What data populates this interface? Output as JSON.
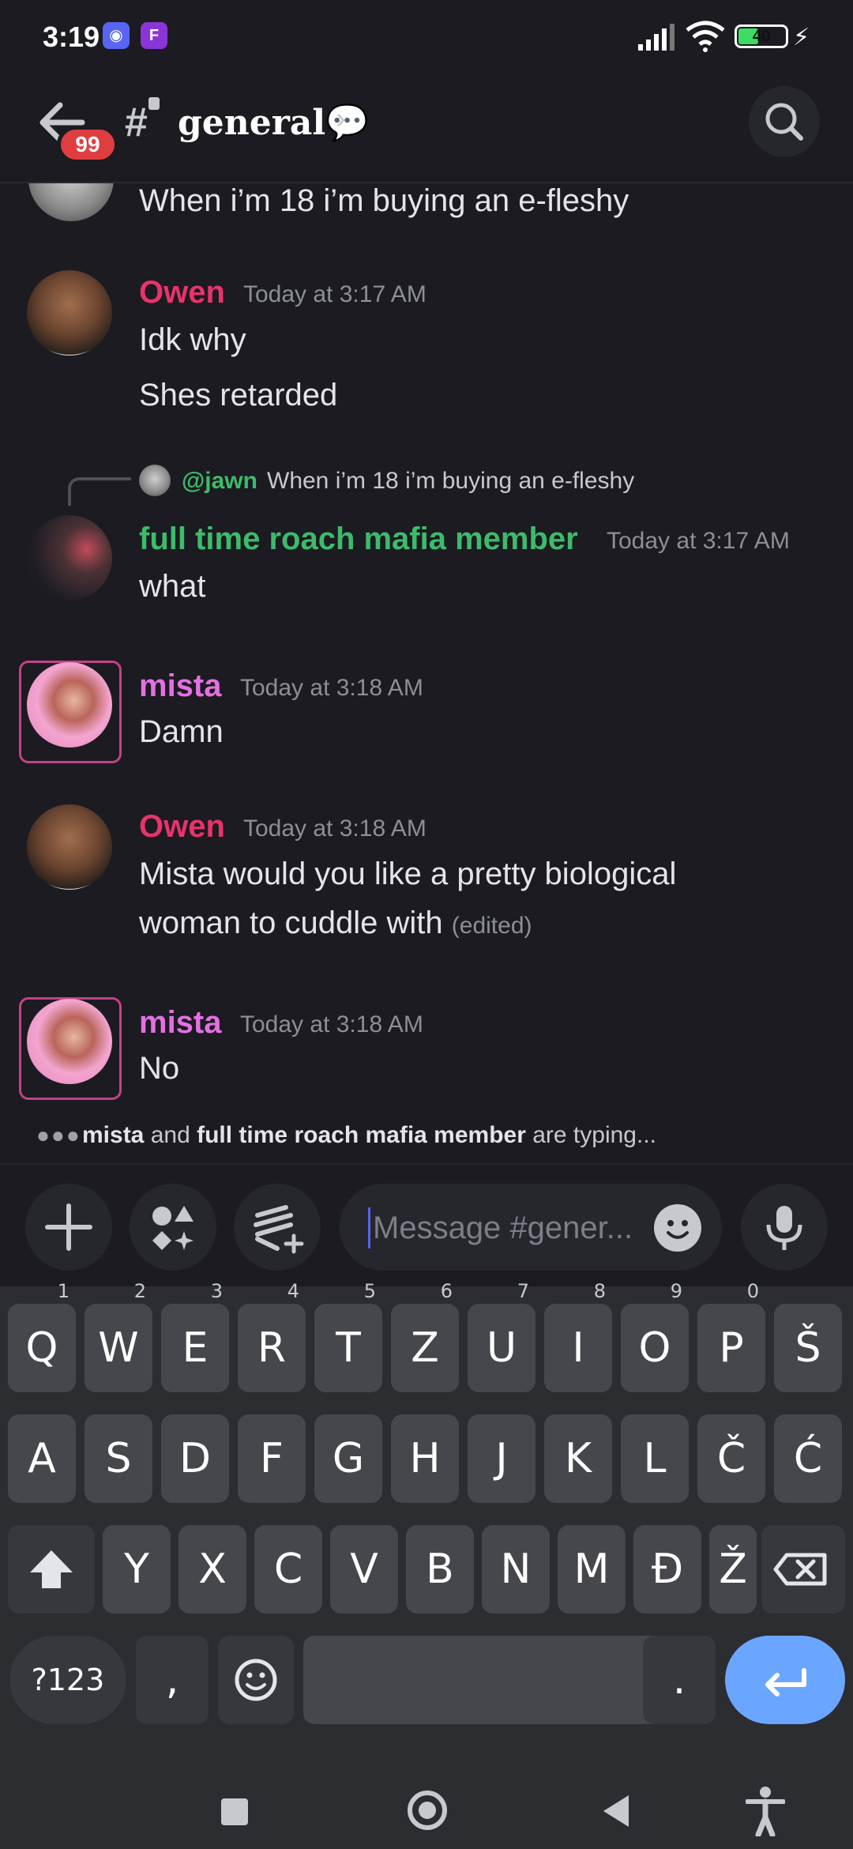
{
  "status_bar": {
    "time": "3:19",
    "battery": "40"
  },
  "header": {
    "badge": "99",
    "channel_name": "general💬"
  },
  "messages": [
    {
      "id": "m0",
      "text": "When i’m 18 i’m buying an e-fleshy"
    },
    {
      "id": "m1",
      "user": "Owen",
      "user_color": "#e8336b",
      "timestamp": "Today at 3:17 AM",
      "lines": [
        "Idk why",
        "Shes retarded"
      ]
    },
    {
      "id": "m2",
      "reply": {
        "user": "@jawn",
        "text": "When i’m 18 i’m buying an e-fleshy"
      },
      "user": "full time roach mafia member",
      "user_color": "#3dbb6b",
      "timestamp": "Today at 3:17 AM",
      "lines": [
        "what"
      ]
    },
    {
      "id": "m3",
      "user": "mista",
      "user_color": "#e470e2",
      "timestamp": "Today at 3:18 AM",
      "lines": [
        "Damn"
      ]
    },
    {
      "id": "m4",
      "user": "Owen",
      "user_color": "#e8336b",
      "timestamp": "Today at 3:18 AM",
      "lines": [
        "Mista would you like a pretty biological",
        "woman to cuddle with"
      ],
      "edited": "(edited)"
    },
    {
      "id": "m5",
      "user": "mista",
      "user_color": "#e470e2",
      "timestamp": "Today at 3:18 AM",
      "lines": [
        "No"
      ]
    }
  ],
  "typing": {
    "user1": "mista",
    "and": " and ",
    "user2": "full time roach mafia member",
    "suffix": " are typing..."
  },
  "input": {
    "placeholder": "Message #gener..."
  },
  "keyboard": {
    "row1": [
      "Q",
      "W",
      "E",
      "R",
      "T",
      "Z",
      "U",
      "I",
      "O",
      "P",
      "Š"
    ],
    "row1_hints": [
      "1",
      "2",
      "3",
      "4",
      "5",
      "6",
      "7",
      "8",
      "9",
      "0",
      ""
    ],
    "row2": [
      "A",
      "S",
      "D",
      "F",
      "G",
      "H",
      "J",
      "K",
      "L",
      "Č",
      "Ć"
    ],
    "row3": [
      "Y",
      "X",
      "C",
      "V",
      "B",
      "N",
      "M",
      "Đ",
      "Ž"
    ],
    "symbols": "?123",
    "comma": ",",
    "period": "."
  },
  "icons": {
    "back": "arrow-left-icon",
    "search": "search-icon",
    "plus": "plus-icon",
    "apps": "apps-icon",
    "gift": "gift-icon",
    "emoji": "emoji-icon",
    "mic": "microphone-icon",
    "shift": "shift-icon",
    "backspace": "backspace-icon",
    "enter": "enter-icon"
  }
}
